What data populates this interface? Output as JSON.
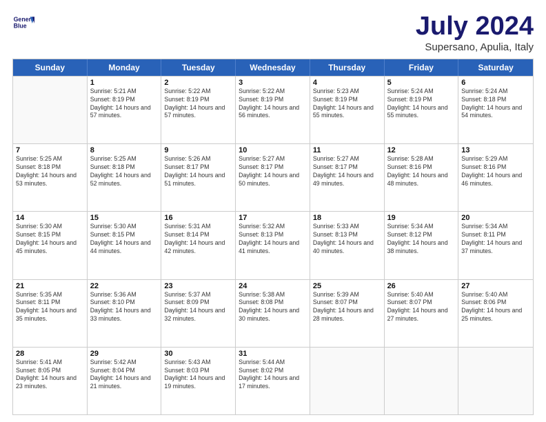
{
  "logo": {
    "line1": "General",
    "line2": "Blue"
  },
  "title": "July 2024",
  "subtitle": "Supersano, Apulia, Italy",
  "header_days": [
    "Sunday",
    "Monday",
    "Tuesday",
    "Wednesday",
    "Thursday",
    "Friday",
    "Saturday"
  ],
  "weeks": [
    [
      {
        "day": "",
        "sunrise": "",
        "sunset": "",
        "daylight": ""
      },
      {
        "day": "1",
        "sunrise": "Sunrise: 5:21 AM",
        "sunset": "Sunset: 8:19 PM",
        "daylight": "Daylight: 14 hours and 57 minutes."
      },
      {
        "day": "2",
        "sunrise": "Sunrise: 5:22 AM",
        "sunset": "Sunset: 8:19 PM",
        "daylight": "Daylight: 14 hours and 57 minutes."
      },
      {
        "day": "3",
        "sunrise": "Sunrise: 5:22 AM",
        "sunset": "Sunset: 8:19 PM",
        "daylight": "Daylight: 14 hours and 56 minutes."
      },
      {
        "day": "4",
        "sunrise": "Sunrise: 5:23 AM",
        "sunset": "Sunset: 8:19 PM",
        "daylight": "Daylight: 14 hours and 55 minutes."
      },
      {
        "day": "5",
        "sunrise": "Sunrise: 5:24 AM",
        "sunset": "Sunset: 8:19 PM",
        "daylight": "Daylight: 14 hours and 55 minutes."
      },
      {
        "day": "6",
        "sunrise": "Sunrise: 5:24 AM",
        "sunset": "Sunset: 8:18 PM",
        "daylight": "Daylight: 14 hours and 54 minutes."
      }
    ],
    [
      {
        "day": "7",
        "sunrise": "Sunrise: 5:25 AM",
        "sunset": "Sunset: 8:18 PM",
        "daylight": "Daylight: 14 hours and 53 minutes."
      },
      {
        "day": "8",
        "sunrise": "Sunrise: 5:25 AM",
        "sunset": "Sunset: 8:18 PM",
        "daylight": "Daylight: 14 hours and 52 minutes."
      },
      {
        "day": "9",
        "sunrise": "Sunrise: 5:26 AM",
        "sunset": "Sunset: 8:17 PM",
        "daylight": "Daylight: 14 hours and 51 minutes."
      },
      {
        "day": "10",
        "sunrise": "Sunrise: 5:27 AM",
        "sunset": "Sunset: 8:17 PM",
        "daylight": "Daylight: 14 hours and 50 minutes."
      },
      {
        "day": "11",
        "sunrise": "Sunrise: 5:27 AM",
        "sunset": "Sunset: 8:17 PM",
        "daylight": "Daylight: 14 hours and 49 minutes."
      },
      {
        "day": "12",
        "sunrise": "Sunrise: 5:28 AM",
        "sunset": "Sunset: 8:16 PM",
        "daylight": "Daylight: 14 hours and 48 minutes."
      },
      {
        "day": "13",
        "sunrise": "Sunrise: 5:29 AM",
        "sunset": "Sunset: 8:16 PM",
        "daylight": "Daylight: 14 hours and 46 minutes."
      }
    ],
    [
      {
        "day": "14",
        "sunrise": "Sunrise: 5:30 AM",
        "sunset": "Sunset: 8:15 PM",
        "daylight": "Daylight: 14 hours and 45 minutes."
      },
      {
        "day": "15",
        "sunrise": "Sunrise: 5:30 AM",
        "sunset": "Sunset: 8:15 PM",
        "daylight": "Daylight: 14 hours and 44 minutes."
      },
      {
        "day": "16",
        "sunrise": "Sunrise: 5:31 AM",
        "sunset": "Sunset: 8:14 PM",
        "daylight": "Daylight: 14 hours and 42 minutes."
      },
      {
        "day": "17",
        "sunrise": "Sunrise: 5:32 AM",
        "sunset": "Sunset: 8:13 PM",
        "daylight": "Daylight: 14 hours and 41 minutes."
      },
      {
        "day": "18",
        "sunrise": "Sunrise: 5:33 AM",
        "sunset": "Sunset: 8:13 PM",
        "daylight": "Daylight: 14 hours and 40 minutes."
      },
      {
        "day": "19",
        "sunrise": "Sunrise: 5:34 AM",
        "sunset": "Sunset: 8:12 PM",
        "daylight": "Daylight: 14 hours and 38 minutes."
      },
      {
        "day": "20",
        "sunrise": "Sunrise: 5:34 AM",
        "sunset": "Sunset: 8:11 PM",
        "daylight": "Daylight: 14 hours and 37 minutes."
      }
    ],
    [
      {
        "day": "21",
        "sunrise": "Sunrise: 5:35 AM",
        "sunset": "Sunset: 8:11 PM",
        "daylight": "Daylight: 14 hours and 35 minutes."
      },
      {
        "day": "22",
        "sunrise": "Sunrise: 5:36 AM",
        "sunset": "Sunset: 8:10 PM",
        "daylight": "Daylight: 14 hours and 33 minutes."
      },
      {
        "day": "23",
        "sunrise": "Sunrise: 5:37 AM",
        "sunset": "Sunset: 8:09 PM",
        "daylight": "Daylight: 14 hours and 32 minutes."
      },
      {
        "day": "24",
        "sunrise": "Sunrise: 5:38 AM",
        "sunset": "Sunset: 8:08 PM",
        "daylight": "Daylight: 14 hours and 30 minutes."
      },
      {
        "day": "25",
        "sunrise": "Sunrise: 5:39 AM",
        "sunset": "Sunset: 8:07 PM",
        "daylight": "Daylight: 14 hours and 28 minutes."
      },
      {
        "day": "26",
        "sunrise": "Sunrise: 5:40 AM",
        "sunset": "Sunset: 8:07 PM",
        "daylight": "Daylight: 14 hours and 27 minutes."
      },
      {
        "day": "27",
        "sunrise": "Sunrise: 5:40 AM",
        "sunset": "Sunset: 8:06 PM",
        "daylight": "Daylight: 14 hours and 25 minutes."
      }
    ],
    [
      {
        "day": "28",
        "sunrise": "Sunrise: 5:41 AM",
        "sunset": "Sunset: 8:05 PM",
        "daylight": "Daylight: 14 hours and 23 minutes."
      },
      {
        "day": "29",
        "sunrise": "Sunrise: 5:42 AM",
        "sunset": "Sunset: 8:04 PM",
        "daylight": "Daylight: 14 hours and 21 minutes."
      },
      {
        "day": "30",
        "sunrise": "Sunrise: 5:43 AM",
        "sunset": "Sunset: 8:03 PM",
        "daylight": "Daylight: 14 hours and 19 minutes."
      },
      {
        "day": "31",
        "sunrise": "Sunrise: 5:44 AM",
        "sunset": "Sunset: 8:02 PM",
        "daylight": "Daylight: 14 hours and 17 minutes."
      },
      {
        "day": "",
        "sunrise": "",
        "sunset": "",
        "daylight": ""
      },
      {
        "day": "",
        "sunrise": "",
        "sunset": "",
        "daylight": ""
      },
      {
        "day": "",
        "sunrise": "",
        "sunset": "",
        "daylight": ""
      }
    ]
  ]
}
